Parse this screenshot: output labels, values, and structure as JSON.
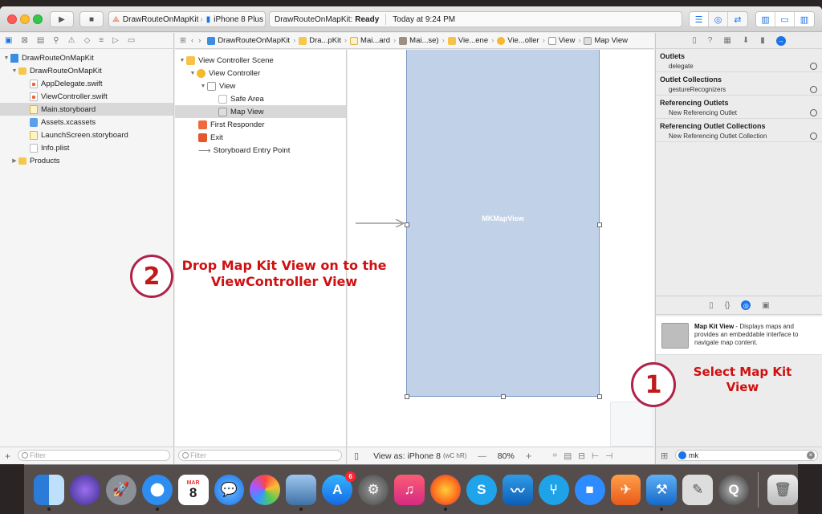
{
  "toolbar": {
    "scheme_target": "DrawRouteOnMapKit",
    "device": "iPhone 8 Plus",
    "status_project": "DrawRouteOnMapKit:",
    "status_state": "Ready",
    "status_time": "Today at 9:24 PM"
  },
  "navigator": {
    "items": [
      {
        "label": "DrawRouteOnMapKit",
        "icon": "project-icon"
      },
      {
        "label": "DrawRouteOnMapKit",
        "icon": "folder-icon"
      },
      {
        "label": "AppDelegate.swift",
        "icon": "swift-file-icon"
      },
      {
        "label": "ViewController.swift",
        "icon": "swift-file-icon"
      },
      {
        "label": "Main.storyboard",
        "icon": "storyboard-icon"
      },
      {
        "label": "Assets.xcassets",
        "icon": "assets-icon"
      },
      {
        "label": "LaunchScreen.storyboard",
        "icon": "storyboard-icon"
      },
      {
        "label": "Info.plist",
        "icon": "plist-icon"
      },
      {
        "label": "Products",
        "icon": "folder-icon"
      }
    ],
    "filter_placeholder": "Filter"
  },
  "jumpbar": {
    "crumbs": [
      "DrawRouteOnMapKit",
      "Dra...pKit",
      "Mai...ard",
      "Mai...se)",
      "Vie...ene",
      "Vie...oller",
      "View",
      "Map View"
    ]
  },
  "outline": {
    "items": [
      {
        "label": "View Controller Scene"
      },
      {
        "label": "View Controller"
      },
      {
        "label": "View"
      },
      {
        "label": "Safe Area"
      },
      {
        "label": "Map View"
      },
      {
        "label": "First Responder"
      },
      {
        "label": "Exit"
      },
      {
        "label": "Storyboard Entry Point"
      }
    ],
    "filter_placeholder": "Filter"
  },
  "canvas": {
    "mapview_label": "MKMapView",
    "view_as": "View as: iPhone 8",
    "size_class": "(wC hR)",
    "zoom": "80%"
  },
  "inspector": {
    "sections": [
      {
        "title": "Outlets",
        "rows": [
          "delegate"
        ]
      },
      {
        "title": "Outlet Collections",
        "rows": [
          "gestureRecognizers"
        ]
      },
      {
        "title": "Referencing Outlets",
        "rows": [
          "New Referencing Outlet"
        ]
      },
      {
        "title": "Referencing Outlet Collections",
        "rows": [
          "New Referencing Outlet Collection"
        ]
      }
    ],
    "library_item_title": "Map Kit View",
    "library_item_desc": " - Displays maps and provides an embeddable interface to navigate map content.",
    "search_value": "mk"
  },
  "annotations": {
    "step1_number": "1",
    "step1_text": "Select Map Kit View",
    "step2_number": "2",
    "step2_text": "Drop Map Kit View on to the ViewController View",
    "color": "#d01010"
  },
  "dock": {
    "calendar_month": "MAR",
    "calendar_day": "8",
    "appstore_badge": "6"
  }
}
